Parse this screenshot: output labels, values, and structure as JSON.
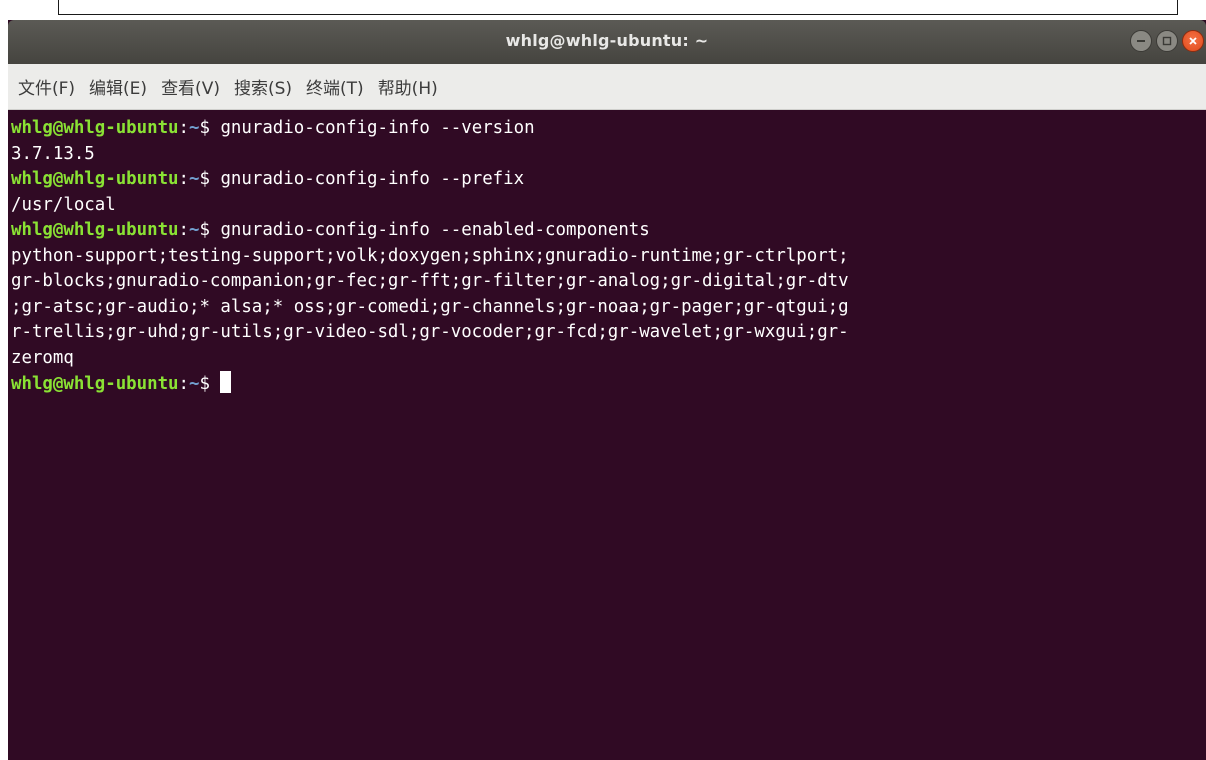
{
  "window": {
    "title": "whlg@whlg-ubuntu: ~"
  },
  "menubar": {
    "items": [
      {
        "label": "文件(F)"
      },
      {
        "label": "编辑(E)"
      },
      {
        "label": "查看(V)"
      },
      {
        "label": "搜索(S)"
      },
      {
        "label": "终端(T)"
      },
      {
        "label": "帮助(H)"
      }
    ]
  },
  "terminal": {
    "prompt": {
      "user_host": "whlg@whlg-ubuntu",
      "colon": ":",
      "path": "~",
      "symbol": "$ "
    },
    "commands": [
      "gnuradio-config-info --version",
      "gnuradio-config-info --prefix",
      "gnuradio-config-info --enabled-components"
    ],
    "outputs": [
      [
        "3.7.13.5"
      ],
      [
        "/usr/local"
      ],
      [
        "python-support;testing-support;volk;doxygen;sphinx;gnuradio-runtime;gr-ctrlport;",
        "gr-blocks;gnuradio-companion;gr-fec;gr-fft;gr-filter;gr-analog;gr-digital;gr-dtv",
        ";gr-atsc;gr-audio;* alsa;* oss;gr-comedi;gr-channels;gr-noaa;gr-pager;gr-qtgui;g",
        "r-trellis;gr-uhd;gr-utils;gr-video-sdl;gr-vocoder;gr-fcd;gr-wavelet;gr-wxgui;gr-",
        "zeromq"
      ]
    ]
  },
  "colors": {
    "terminal_bg": "#300a24",
    "prompt_user": "#8ae234",
    "prompt_path": "#729fcf",
    "close_button": "#e95420"
  },
  "icons": {
    "minimize": "minimize-icon",
    "maximize": "maximize-icon",
    "close": "close-icon"
  }
}
